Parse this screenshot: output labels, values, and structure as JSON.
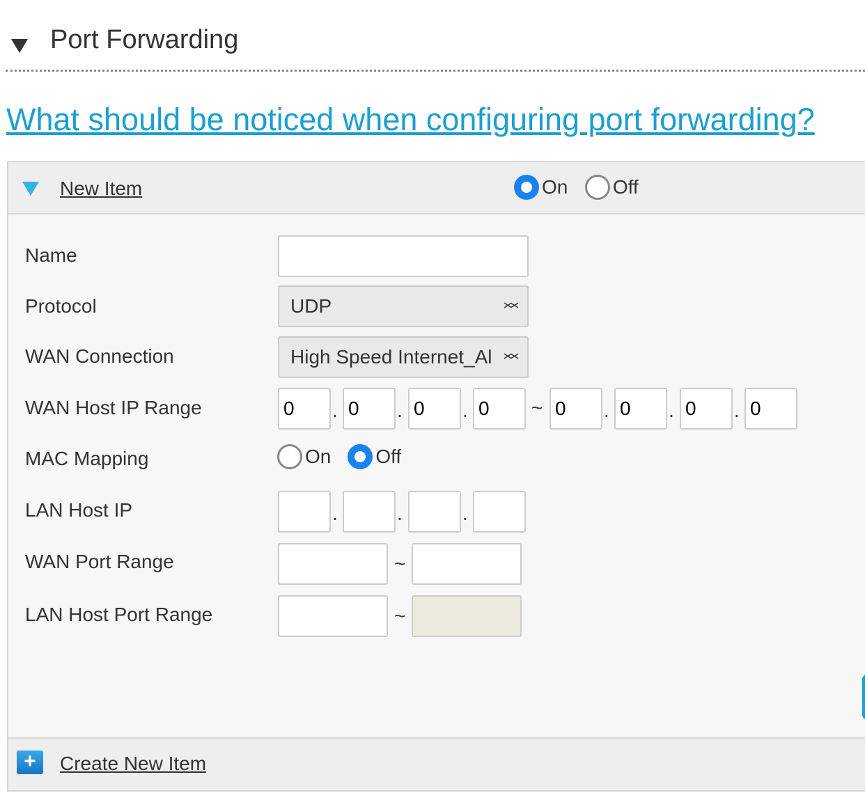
{
  "section": {
    "title": "Port Forwarding",
    "help_link": "What should be noticed when configuring port forwarding?"
  },
  "item": {
    "title": "New Item",
    "status_on": "On",
    "status_off": "Off",
    "status": "On"
  },
  "form": {
    "name_label": "Name",
    "name_value": "",
    "protocol_label": "Protocol",
    "protocol_value": "UDP",
    "wan_label": "WAN Connection",
    "wan_value": "High Speed Internet_Al",
    "wan_ip_label": "WAN Host IP Range",
    "wan_ip_start": [
      "0",
      "0",
      "0",
      "0"
    ],
    "wan_ip_end": [
      "0",
      "0",
      "0",
      "0"
    ],
    "mac_label": "MAC Mapping",
    "mac_on": "On",
    "mac_off": "Off",
    "mac_value": "Off",
    "lan_ip_label": "LAN Host IP",
    "lan_ip": [
      "",
      "",
      "",
      ""
    ],
    "wan_port_label": "WAN Port Range",
    "lan_port_label": "LAN Host Port Range",
    "dot": ".",
    "tilde": "~"
  },
  "footer": {
    "create_label": "Create New Item"
  },
  "colors": {
    "accent": "#1a9fd0",
    "radio": "#1a82f0"
  }
}
